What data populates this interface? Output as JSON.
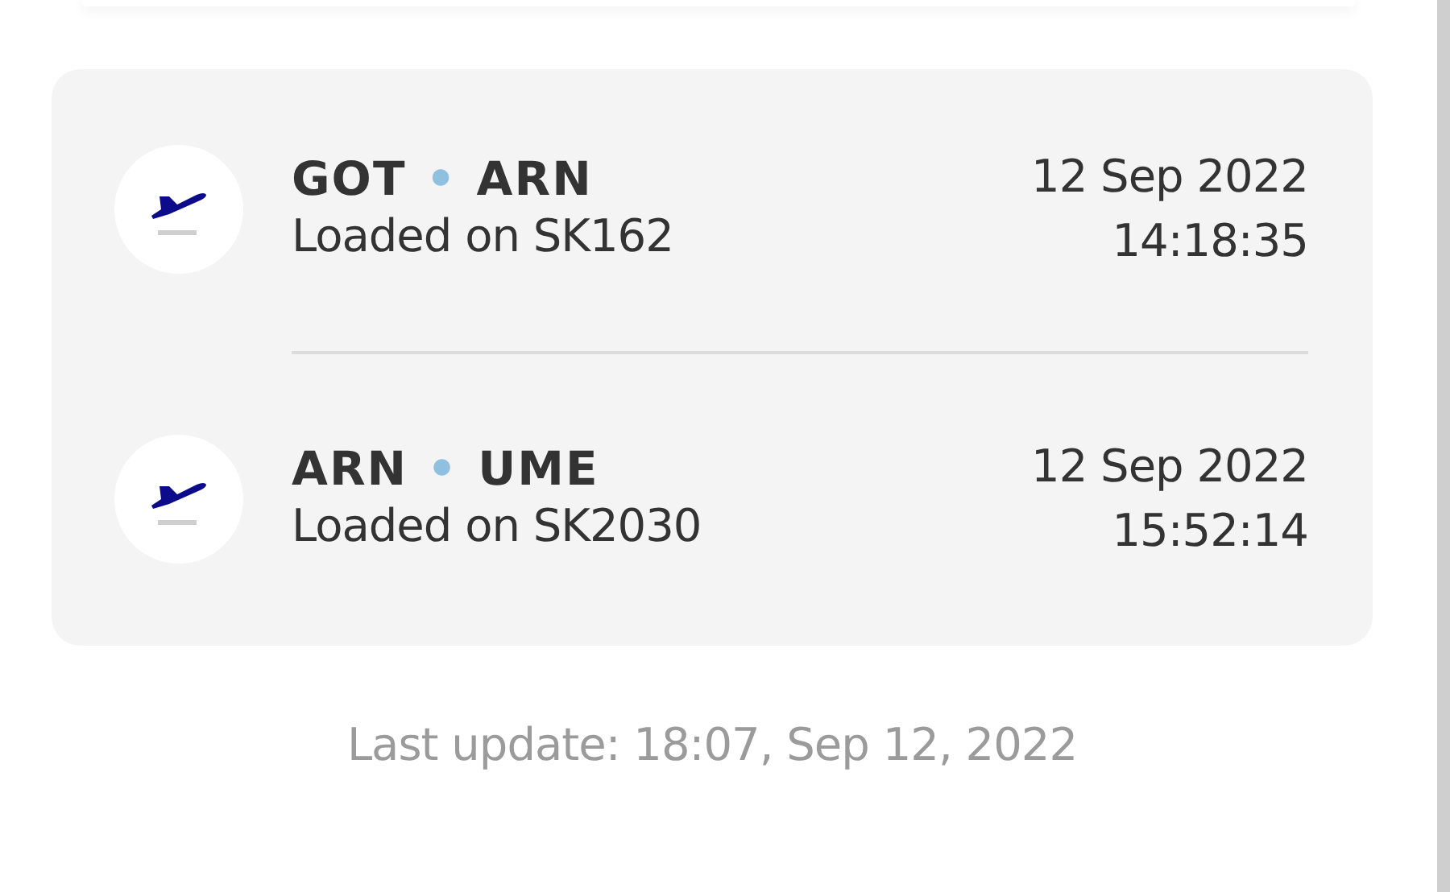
{
  "flights": [
    {
      "from": "GOT",
      "separator": "•",
      "to": "ARN",
      "status": "Loaded on SK162",
      "date": "12 Sep 2022",
      "time": "14:18:35"
    },
    {
      "from": "ARN",
      "separator": "•",
      "to": "UME",
      "status": "Loaded on SK2030",
      "date": "12 Sep 2022",
      "time": "15:52:14"
    }
  ],
  "last_update": "Last update: 18:07, Sep 12, 2022"
}
